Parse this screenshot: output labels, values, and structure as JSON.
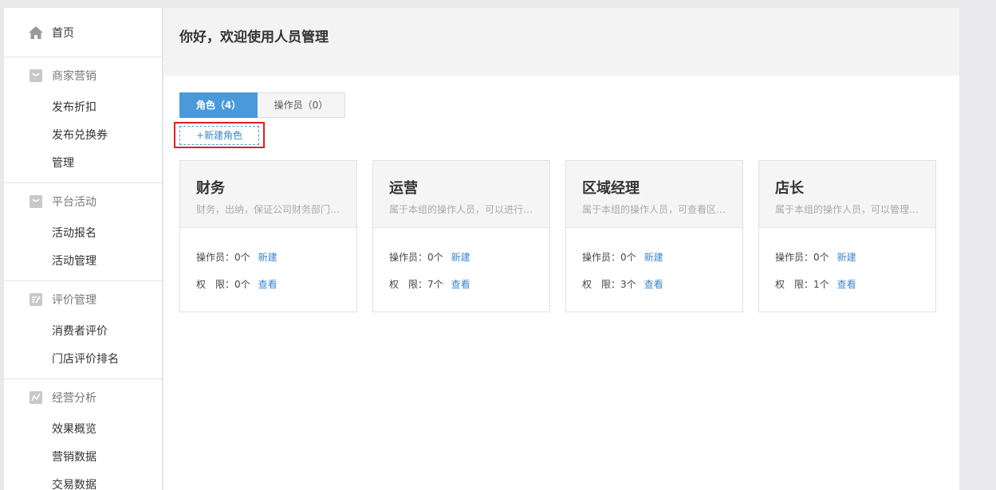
{
  "sidebar": {
    "home": "首页",
    "groups": [
      {
        "title": "商家营销",
        "icon": "shopping-bag-icon",
        "items": [
          "发布折扣",
          "发布兑换券",
          "管理"
        ]
      },
      {
        "title": "平台活动",
        "icon": "shopping-bag-icon",
        "items": [
          "活动报名",
          "活动管理"
        ]
      },
      {
        "title": "评价管理",
        "icon": "edit-review-icon",
        "items": [
          "消费者评价",
          "门店评价排名"
        ]
      },
      {
        "title": "经营分析",
        "icon": "chart-line-icon",
        "items": [
          "效果概览",
          "营销数据",
          "交易数据"
        ]
      }
    ]
  },
  "header": {
    "title": "你好，欢迎使用人员管理"
  },
  "tabs": [
    {
      "label": "角色（4）"
    },
    {
      "label": "操作员（0）"
    }
  ],
  "new_role_button": "+新建角色",
  "labels": {
    "operators": "操作员：",
    "permissions": "权　限：",
    "new": "新建",
    "view": "查看"
  },
  "roles": [
    {
      "name": "财务",
      "desc": "财务，出纳，保证公司财务部门的正常运作",
      "operators": "0个",
      "permissions": "0个"
    },
    {
      "name": "运营",
      "desc": "属于本组的操作人员，可以进行营销活动的管理",
      "operators": "0个",
      "permissions": "7个"
    },
    {
      "name": "区域经理",
      "desc": "属于本组的操作人员，可查看区域内数据",
      "operators": "0个",
      "permissions": "3个"
    },
    {
      "name": "店长",
      "desc": "属于本组的操作人员，可以管理门店日常",
      "operators": "0个",
      "permissions": "1个"
    }
  ],
  "colors": {
    "accent": "#4a9ad9",
    "link": "#3b86c9",
    "highlight": "#e02020"
  }
}
